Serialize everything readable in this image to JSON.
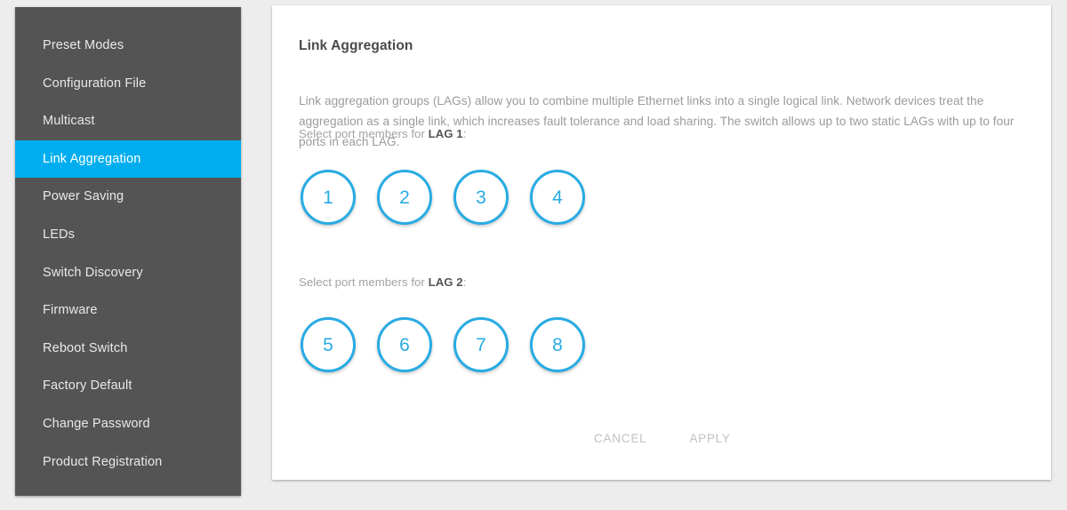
{
  "theme": {
    "accent": "#00AEEF",
    "port_accent": "#28ABE3",
    "sidebar_bg": "#555454",
    "page_bg": "#ededed",
    "card_bg": "#ffffff",
    "title_color": "#4a4a4a",
    "muted_text": "#9b9b9b",
    "disabled_btn": "#c2c2c2"
  },
  "sidebar": {
    "items": [
      {
        "label": "Preset Modes",
        "active": false
      },
      {
        "label": "Configuration File",
        "active": false
      },
      {
        "label": "Multicast",
        "active": false
      },
      {
        "label": "Link Aggregation",
        "active": true
      },
      {
        "label": "Power Saving",
        "active": false
      },
      {
        "label": "LEDs",
        "active": false
      },
      {
        "label": "Switch Discovery",
        "active": false
      },
      {
        "label": "Firmware",
        "active": false
      },
      {
        "label": "Reboot Switch",
        "active": false
      },
      {
        "label": "Factory Default",
        "active": false
      },
      {
        "label": "Change Password",
        "active": false
      },
      {
        "label": "Product Registration",
        "active": false
      }
    ]
  },
  "main": {
    "title": "Link Aggregation",
    "description": "Link aggregation groups (LAGs) allow you to combine multiple Ethernet links into a single logical link. Network devices treat the aggregation as a single link, which increases fault tolerance and load sharing. The switch allows up to two static LAGs with up to four ports in each LAG.",
    "lag_groups": [
      {
        "label_prefix": "Select port members for ",
        "label_name": "LAG 1",
        "label_suffix": ":",
        "ports": [
          {
            "number": "1",
            "selected": false
          },
          {
            "number": "2",
            "selected": false
          },
          {
            "number": "3",
            "selected": false
          },
          {
            "number": "4",
            "selected": false
          }
        ]
      },
      {
        "label_prefix": "Select port members for ",
        "label_name": "LAG 2",
        "label_suffix": ":",
        "ports": [
          {
            "number": "5",
            "selected": false
          },
          {
            "number": "6",
            "selected": false
          },
          {
            "number": "7",
            "selected": false
          },
          {
            "number": "8",
            "selected": false
          }
        ]
      }
    ],
    "actions": {
      "cancel_label": "CANCEL",
      "apply_label": "APPLY"
    }
  }
}
